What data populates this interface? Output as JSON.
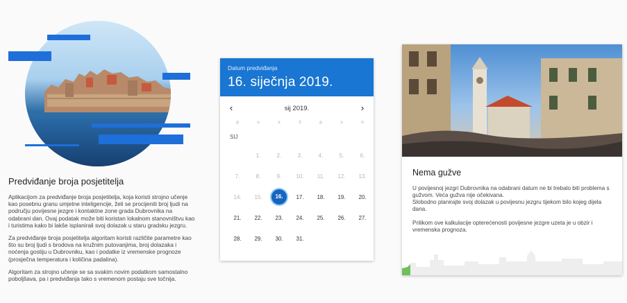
{
  "intro": {
    "title": "Predviđanje broja posjetitelja",
    "p1": "Aplikacijom za predviđanje broja posjetitelja, koja koristi strojno učenje kao posebnu granu umjetne inteligencije, želi se procijeniti broj ljudi na području povijesne jezgre i kontaktne zone grada Dubrovnika na odabrani dan. Ovaj podatak može biti koristan lokalnom stanovništvu kao i turistima kako bi lakše isplanirali svoj dolazak u staru gradsku jezgru.",
    "p2": "Za predviđanje broja posjetitelja algoritam koristi različite parametre kao što su broj ljudi s brodova na kružnim putovanjima, broj dolazaka i noćenja gostiju u Dubrovniku, kao i podatke iz vremenske prognoze (prosječna temperatura i količina padalina).",
    "p3": "Algoritam za strojno učenje se sa svakim novim podatkom samostalno poboljšava, pa i predviđanja tako s vremenom postaju sve točnija."
  },
  "calendar": {
    "header_label": "Datum predviđanja",
    "header_date": "16. siječnja 2019.",
    "month_label": "sij 2019.",
    "prev_icon": "‹",
    "next_icon": "›",
    "weekdays": [
      "p",
      "u",
      "s",
      "č",
      "p",
      "s",
      "n"
    ],
    "month_tag": "SIJ",
    "weeks": [
      [
        {
          "d": "1.",
          "s": "dis"
        },
        {
          "d": "2.",
          "s": "dis"
        },
        {
          "d": "3.",
          "s": "dis"
        },
        {
          "d": "4.",
          "s": "dis"
        },
        {
          "d": "5.",
          "s": "dis"
        },
        {
          "d": "6.",
          "s": "dis"
        }
      ],
      [
        {
          "d": "7.",
          "s": "dis"
        },
        {
          "d": "8.",
          "s": "dis"
        },
        {
          "d": "9.",
          "s": "dis"
        },
        {
          "d": "10.",
          "s": "dis"
        },
        {
          "d": "11.",
          "s": "dis"
        },
        {
          "d": "12.",
          "s": "dis"
        },
        {
          "d": "13.",
          "s": "dis"
        }
      ],
      [
        {
          "d": "14.",
          "s": "dis"
        },
        {
          "d": "15.",
          "s": "dis"
        },
        {
          "d": "16.",
          "s": "sel"
        },
        {
          "d": "17.",
          "s": ""
        },
        {
          "d": "18.",
          "s": ""
        },
        {
          "d": "19.",
          "s": ""
        },
        {
          "d": "20.",
          "s": ""
        }
      ],
      [
        {
          "d": "21.",
          "s": ""
        },
        {
          "d": "22.",
          "s": ""
        },
        {
          "d": "23.",
          "s": ""
        },
        {
          "d": "24.",
          "s": ""
        },
        {
          "d": "25.",
          "s": ""
        },
        {
          "d": "26.",
          "s": ""
        },
        {
          "d": "27.",
          "s": ""
        }
      ],
      [
        {
          "d": "28.",
          "s": ""
        },
        {
          "d": "29.",
          "s": ""
        },
        {
          "d": "30.",
          "s": ""
        },
        {
          "d": "31.",
          "s": ""
        }
      ]
    ]
  },
  "result": {
    "title": "Nema gužve",
    "p1": "U povijesnoj jezgri Dubrovnika na odabrani datum ne bi trebalo biti problema s gužvom. Veća gužva nije očekivana.",
    "p1b": "Slobodno planirajte svoj dolazak u povijesnu jezgru tijekom bilo kojeg dijela dana.",
    "p2": "Prilikom ove kalkulacije opterećenosti povijesne jezgre uzeta je u obzir i vremenska prognoza.",
    "indicator_color": "#6fbf5a"
  },
  "colors": {
    "accent": "#1976d2",
    "selected": "#1565c0"
  }
}
